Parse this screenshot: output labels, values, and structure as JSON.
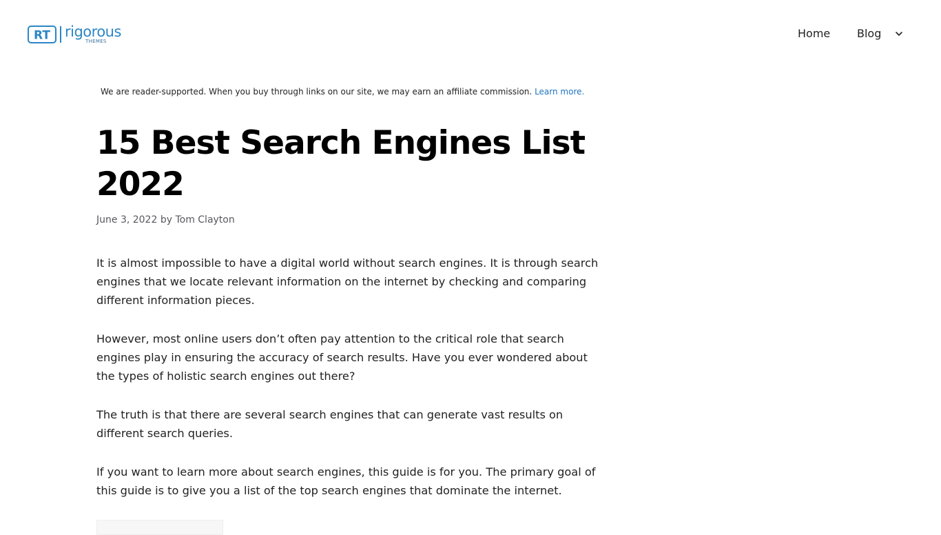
{
  "header": {
    "logo": {
      "mark_text": "RT",
      "word": "rigorous",
      "sub": "THEMES",
      "brand_color": "#2b86c5"
    },
    "nav": {
      "home_label": "Home",
      "blog_label": "Blog",
      "blog_icon": "chevron-down-icon"
    }
  },
  "notice": {
    "text": "We are reader-supported. When you buy through links on our site, we may earn an affiliate commission.",
    "link_label": "Learn more.",
    "link_color": "#1e73be"
  },
  "article": {
    "title": "15 Best Search Engines List 2022",
    "date": "June 3, 2022",
    "by": "by",
    "author": "Tom Clayton",
    "paragraphs": [
      "It is almost impossible to have a digital world without search engines. It is through search engines that we locate relevant information on the internet by checking and comparing different information pieces.",
      "However, most online users don’t often pay attention to the critical role that search engines play in ensuring the accuracy of search results. Have you ever wondered about the types of holistic search engines out there?",
      "The truth is that there are several search engines that can generate vast results on different search queries.",
      "If you want to learn more about search engines, this guide is for you. The primary goal of this guide is to give you a list of the top search engines that dominate the internet."
    ]
  }
}
